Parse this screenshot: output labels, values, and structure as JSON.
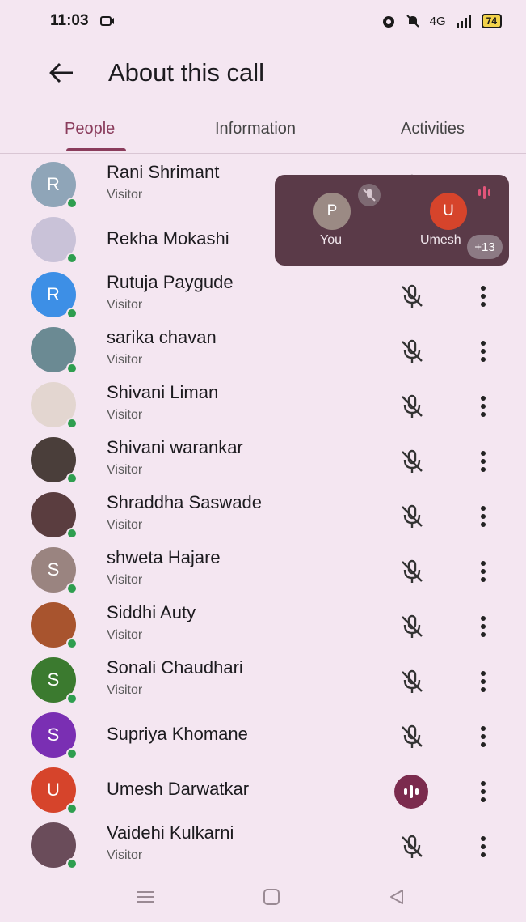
{
  "status": {
    "time": "11:03",
    "network": "4G",
    "battery": "74"
  },
  "header": {
    "title": "About this call"
  },
  "tabs": [
    {
      "label": "People",
      "active": true
    },
    {
      "label": "Information",
      "active": false
    },
    {
      "label": "Activities",
      "active": false
    }
  ],
  "participants": [
    {
      "name": "Rani Shrimant",
      "role": "Visitor",
      "avatar_letter": "R",
      "avatar_color": "#8fa5b8",
      "mic": "muted"
    },
    {
      "name": "Rekha Mokashi",
      "role": "",
      "avatar_letter": "",
      "avatar_color": "#c9c2d8",
      "mic": "muted"
    },
    {
      "name": "Rutuja Paygude",
      "role": "Visitor",
      "avatar_letter": "R",
      "avatar_color": "#3d8fe6",
      "mic": "muted"
    },
    {
      "name": "sarika chavan",
      "role": "Visitor",
      "avatar_letter": "",
      "avatar_color": "#6b8a93",
      "mic": "muted"
    },
    {
      "name": "Shivani Liman",
      "role": "Visitor",
      "avatar_letter": "",
      "avatar_color": "#e3d6d0",
      "mic": "muted"
    },
    {
      "name": "Shivani warankar",
      "role": "Visitor",
      "avatar_letter": "",
      "avatar_color": "#4a3e3a",
      "mic": "muted"
    },
    {
      "name": "Shraddha Saswade",
      "role": "Visitor",
      "avatar_letter": "",
      "avatar_color": "#5a3d3f",
      "mic": "muted"
    },
    {
      "name": "shweta Hajare",
      "role": "Visitor",
      "avatar_letter": "S",
      "avatar_color": "#9a8480",
      "mic": "muted"
    },
    {
      "name": "Siddhi Auty",
      "role": "Visitor",
      "avatar_letter": "",
      "avatar_color": "#a8542e",
      "mic": "muted"
    },
    {
      "name": "Sonali Chaudhari",
      "role": "Visitor",
      "avatar_letter": "S",
      "avatar_color": "#3b7a2f",
      "mic": "muted"
    },
    {
      "name": "Supriya Khomane",
      "role": "",
      "avatar_letter": "S",
      "avatar_color": "#7a2fb3",
      "mic": "muted"
    },
    {
      "name": "Umesh Darwatkar",
      "role": "",
      "avatar_letter": "U",
      "avatar_color": "#d6442b",
      "mic": "speaking"
    },
    {
      "name": "Vaidehi Kulkarni",
      "role": "Visitor",
      "avatar_letter": "",
      "avatar_color": "#6a4c5a",
      "mic": "muted"
    }
  ],
  "pip": {
    "you_letter": "P",
    "you_label": "You",
    "you_color": "#9b8a84",
    "other_letter": "U",
    "other_label": "Umesh",
    "other_color": "#d6442b",
    "more_count": "+13"
  },
  "colors": {
    "accent": "#8a3c5c",
    "presence": "#2e9e4f",
    "background": "#f4e6f1"
  }
}
